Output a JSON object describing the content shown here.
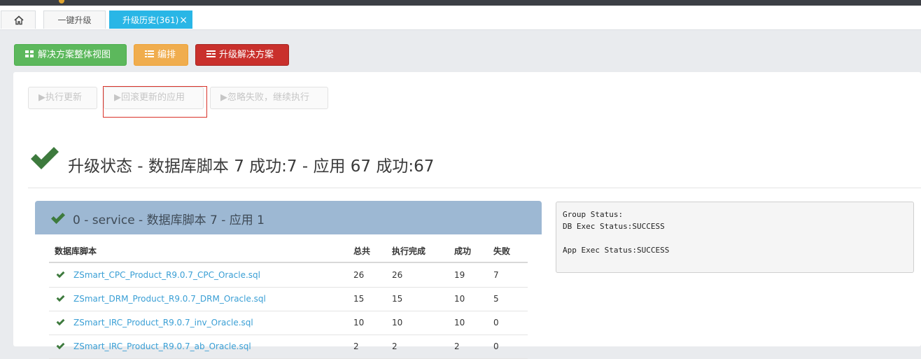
{
  "tabs": {
    "home_icon": "home-icon",
    "one_click": "一键升级",
    "history": "升级历史(361)",
    "close": "×"
  },
  "actions": {
    "overview": "解决方案整体视图",
    "arrange": "编排",
    "upgrade": "升级解决方案"
  },
  "exec_buttons": {
    "execute": "▶执行更新",
    "rollback": "▶回滚更新的应用",
    "ignore": "▶忽略失败，继续执行"
  },
  "status": {
    "title": "升级状态 - 数据库脚本 7 成功:7 - 应用 67 成功:67"
  },
  "group": {
    "title": "0 - service - 数据库脚本 7 - 应用 1",
    "columns": [
      "数据库脚本",
      "总共",
      "执行完成",
      "成功",
      "失败"
    ],
    "rows": [
      {
        "name": "ZSmart_CPC_Product_R9.0.7_CPC_Oracle.sql",
        "total": "26",
        "done": "26",
        "success": "19",
        "fail": "7"
      },
      {
        "name": "ZSmart_DRM_Product_R9.0.7_DRM_Oracle.sql",
        "total": "15",
        "done": "15",
        "success": "10",
        "fail": "5"
      },
      {
        "name": "ZSmart_IRC_Product_R9.0.7_inv_Oracle.sql",
        "total": "10",
        "done": "10",
        "success": "10",
        "fail": "0"
      },
      {
        "name": "ZSmart_IRC_Product_R9.0.7_ab_Oracle.sql",
        "total": "2",
        "done": "2",
        "success": "2",
        "fail": "0"
      }
    ]
  },
  "group_status": {
    "line1": "Group Status:",
    "line2": "DB Exec Status:SUCCESS",
    "line3": "",
    "line4": "App Exec Status:SUCCESS"
  },
  "colors": {
    "active_tab": "#29b6e6",
    "success_green": "#3d7a3d",
    "link": "#3a9fd5"
  }
}
